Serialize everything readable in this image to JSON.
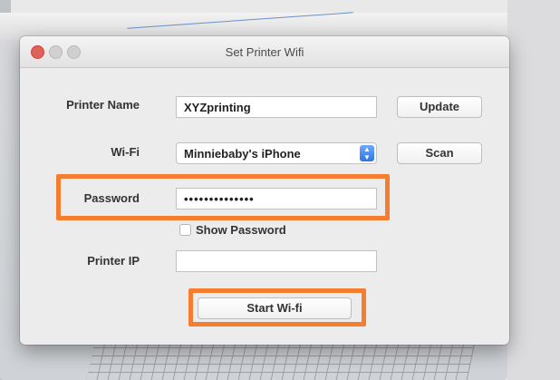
{
  "dialog": {
    "title": "Set Printer Wifi"
  },
  "form": {
    "printer_name_label": "Printer Name",
    "printer_name_value": "XYZprinting",
    "update_label": "Update",
    "wifi_label": "Wi-Fi",
    "wifi_selected": "Minniebaby's iPhone",
    "scan_label": "Scan",
    "password_label": "Password",
    "password_value": "••••••••••••••",
    "show_password_label": "Show Password",
    "show_password_checked": false,
    "printer_ip_label": "Printer IP",
    "printer_ip_value": "",
    "start_label": "Start Wi-fi"
  },
  "colors": {
    "highlight": "#f47d30",
    "close_button": "#e0605a",
    "select_accent": "#2f75e8"
  },
  "icons": {
    "select_arrow": "chevron-up-down-icon"
  }
}
